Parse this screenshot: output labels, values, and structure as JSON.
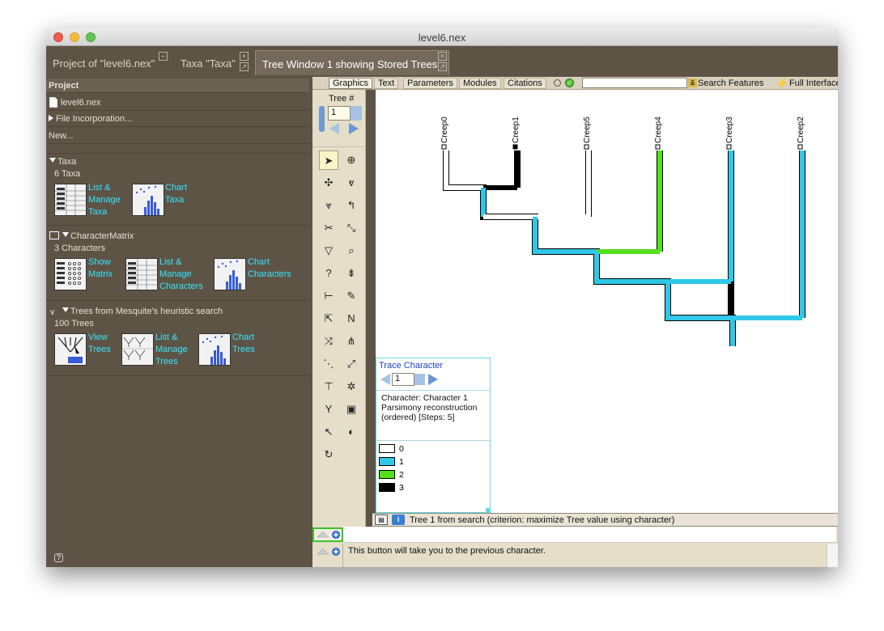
{
  "window": {
    "title": "level6.nex"
  },
  "tabs": [
    {
      "label": "Project of \"level6.nex\""
    },
    {
      "label": "Taxa \"Taxa\""
    },
    {
      "label": "Tree Window 1 showing Stored Trees"
    }
  ],
  "project": {
    "header": "Project",
    "file": "level6.nex",
    "file_incorporation": "File Incorporation...",
    "new": "New...",
    "taxa": {
      "title": "Taxa",
      "count": "6 Taxa",
      "actions": [
        {
          "label": "List &\nManage\nTaxa"
        },
        {
          "label": "Chart\nTaxa"
        }
      ]
    },
    "matrix": {
      "title": "CharacterMatrix",
      "count": "3 Characters",
      "actions": [
        {
          "label": "Show\nMatrix"
        },
        {
          "label": "List &\nManage\nCharacters"
        },
        {
          "label": "Chart\nCharacters"
        }
      ]
    },
    "trees": {
      "title": "Trees from Mesquite's heuristic search",
      "count": "100 Trees",
      "actions": [
        {
          "label": "View\nTrees"
        },
        {
          "label": "List &\nManage\nTrees"
        },
        {
          "label": "Chart\nTrees"
        }
      ]
    }
  },
  "toolbar": {
    "tabs": [
      "Graphics",
      "Text",
      "Parameters",
      "Modules",
      "Citations"
    ],
    "search_features": "Search Features",
    "full_interface": "Full Interface"
  },
  "tree_control": {
    "label": "Tree #",
    "value": "1"
  },
  "taxa_labels": [
    "Creep0",
    "Creep1",
    "Creep5",
    "Creep4",
    "Creep3",
    "Creep2"
  ],
  "trace": {
    "title": "Trace Character",
    "value": "1",
    "info_line1": "Character: Character 1",
    "info_line2": "Parsimony reconstruction",
    "info_line3": "(ordered) [Steps: 5]",
    "states": [
      {
        "label": "0",
        "color": "#ffffff"
      },
      {
        "label": "1",
        "color": "#30c8e8"
      },
      {
        "label": "2",
        "color": "#55e01a"
      },
      {
        "label": "3",
        "color": "#000000"
      }
    ]
  },
  "status": {
    "text": "Tree 1 from search (criterion: maximize Tree value using character)"
  },
  "bottom_message": "This button will take you to the previous character."
}
